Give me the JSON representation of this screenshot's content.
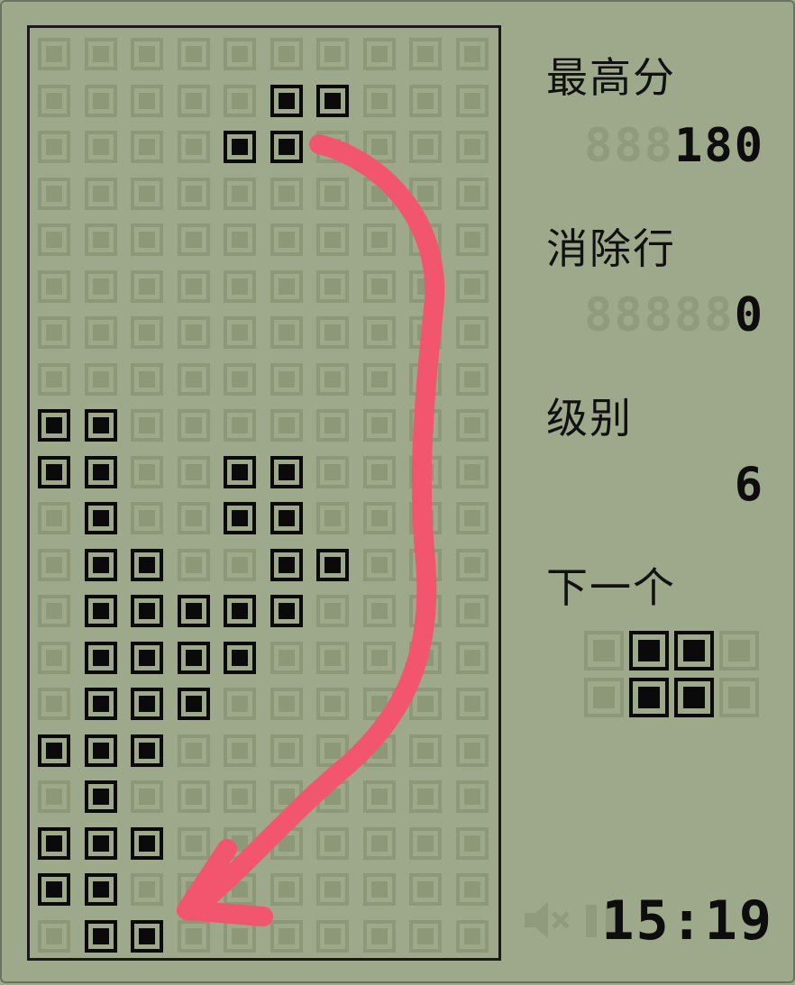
{
  "game": {
    "board_cols": 10,
    "board_rows": 20,
    "filled_cells": [
      [
        1,
        5
      ],
      [
        1,
        6
      ],
      [
        2,
        4
      ],
      [
        2,
        5
      ],
      [
        8,
        0
      ],
      [
        8,
        1
      ],
      [
        9,
        0
      ],
      [
        9,
        1
      ],
      [
        9,
        4
      ],
      [
        9,
        5
      ],
      [
        10,
        1
      ],
      [
        10,
        4
      ],
      [
        10,
        5
      ],
      [
        11,
        1
      ],
      [
        11,
        2
      ],
      [
        11,
        5
      ],
      [
        11,
        6
      ],
      [
        12,
        1
      ],
      [
        12,
        2
      ],
      [
        12,
        3
      ],
      [
        12,
        4
      ],
      [
        12,
        5
      ],
      [
        13,
        1
      ],
      [
        13,
        2
      ],
      [
        13,
        3
      ],
      [
        13,
        4
      ],
      [
        14,
        1
      ],
      [
        14,
        2
      ],
      [
        14,
        3
      ],
      [
        15,
        0
      ],
      [
        15,
        1
      ],
      [
        15,
        2
      ],
      [
        16,
        1
      ],
      [
        17,
        0
      ],
      [
        17,
        1
      ],
      [
        17,
        2
      ],
      [
        18,
        0
      ],
      [
        18,
        1
      ],
      [
        19,
        1
      ],
      [
        19,
        2
      ]
    ]
  },
  "sidebar": {
    "high_score_label": "最高分",
    "high_score_ghost": "888",
    "high_score_value": "180",
    "lines_label": "消除行",
    "lines_ghost": "88888",
    "lines_value": "0",
    "level_label": "级别",
    "level_value": "6",
    "next_label": "下一个",
    "next_piece": [
      [
        0,
        1
      ],
      [
        0,
        2
      ],
      [
        1,
        1
      ],
      [
        1,
        2
      ]
    ],
    "clock": "15:19"
  },
  "icons": {
    "sound": "speaker-muted-icon",
    "pause": "pause-icon"
  },
  "colors": {
    "background": "#9da98a",
    "empty_cell": "#8d9878",
    "filled_cell": "#0a0a0a",
    "annotation_arrow": "#f2566e"
  }
}
